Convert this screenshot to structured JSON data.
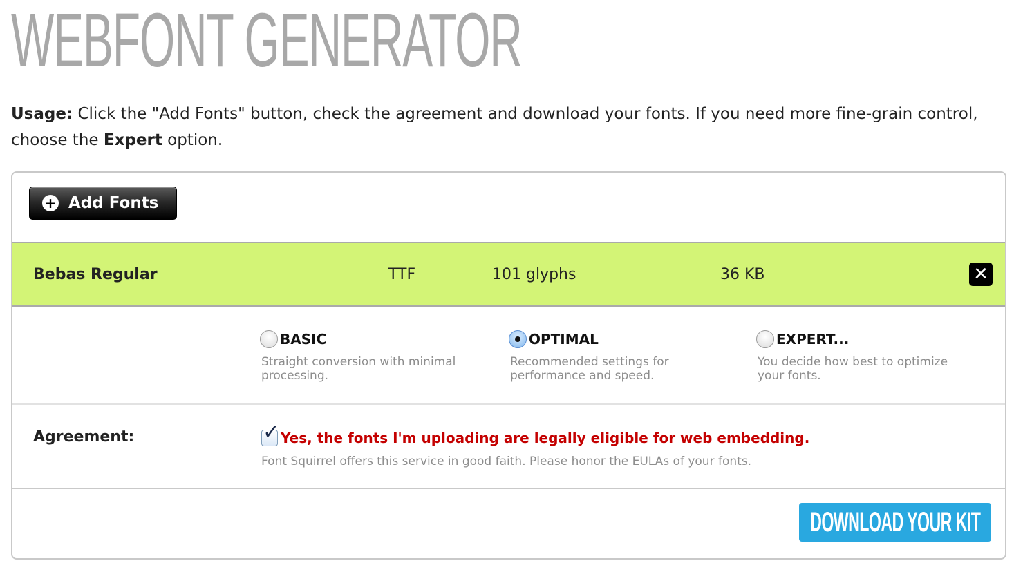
{
  "page": {
    "title": "WEBFONT GENERATOR"
  },
  "usage": {
    "label": "Usage:",
    "text_before_expert": " Click the \"Add Fonts\" button, check the agreement and download your fonts. If you need more fine-grain control, choose the ",
    "expert_word": "Expert",
    "text_after_expert": " option."
  },
  "toolbar": {
    "add_fonts_label": "Add Fonts",
    "add_icon": "plus-circle-icon"
  },
  "font_file": {
    "name": "Bebas Regular",
    "format": "TTF",
    "glyphs": "101 glyphs",
    "size": "36 KB",
    "row_color": "#d3f476",
    "remove_icon": "close-icon"
  },
  "modes": {
    "selected": "optimal",
    "basic": {
      "label": "BASIC",
      "description": "Straight conversion with minimal processing."
    },
    "optimal": {
      "label": "OPTIMAL",
      "description": "Recommended settings for performance and speed."
    },
    "expert": {
      "label": "EXPERT...",
      "description": "You decide how best to optimize your fonts."
    }
  },
  "agreement": {
    "label": "Agreement:",
    "checked": true,
    "checkbox_text": "Yes, the fonts I'm uploading are legally eligible for web embedding.",
    "note": "Font Squirrel offers this service in good faith. Please honor the EULAs of your fonts.",
    "text_color": "#c40000"
  },
  "download": {
    "label": "DOWNLOAD YOUR KIT",
    "color": "#29a8e0"
  }
}
